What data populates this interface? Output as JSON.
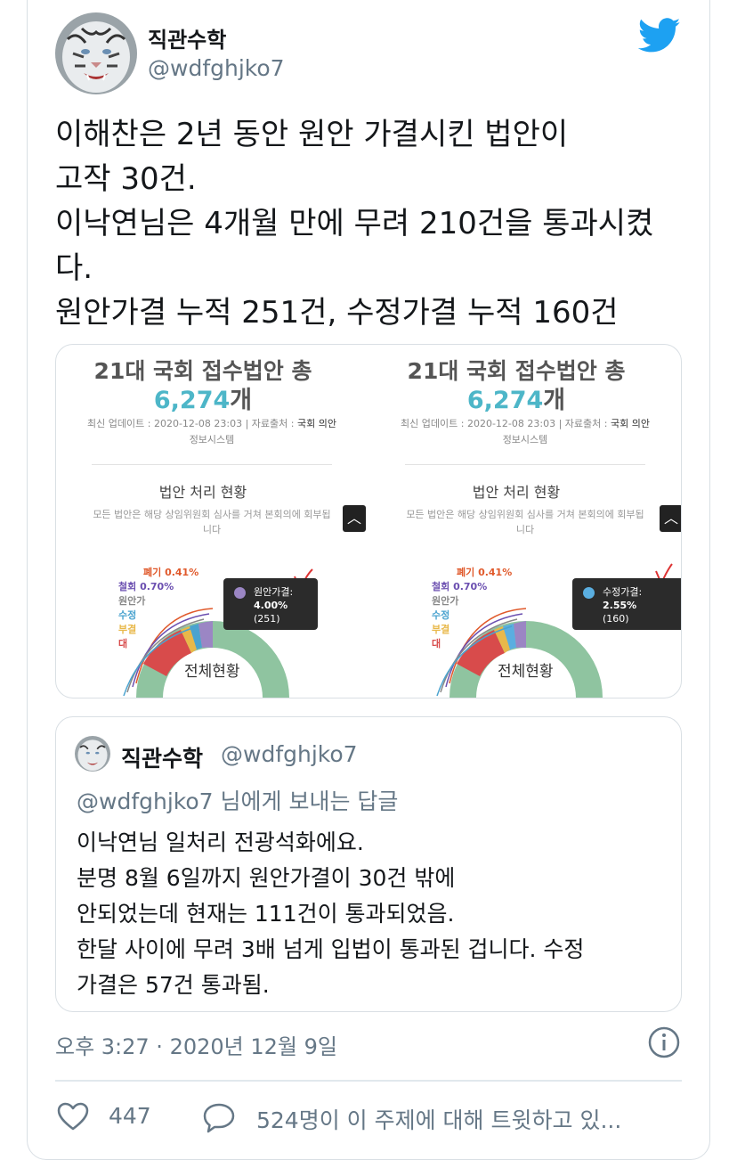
{
  "author": {
    "name": "직관수학",
    "handle": "@wdfghjko7"
  },
  "tweet": {
    "lines": [
      "이해찬은 2년 동안 원안 가결시킨 법안이",
      "고작 30건.",
      "이낙연님은 4개월 만에 무려 210건을 통과시켰",
      "다.",
      "원안가결 누적 251건, 수정가결 누적 160건"
    ]
  },
  "media": {
    "panels": [
      {
        "title": "21대 국회 접수법안 총",
        "count_number": "6,274",
        "count_unit": "개",
        "meta_prefix": "최신 업데이트 : 2020-12-08 23:03 | 자료출처 : ",
        "meta_source": "국회 의안",
        "meta_line2": "정보시스템",
        "subtitle": "법안 처리 현황",
        "desc_line1": "모든 법안은 해당 상임위원회 심사를 거쳐 본회의에 회부됩",
        "desc_line2": "니다",
        "scroll_glyph": "︿",
        "legend": [
          "폐기 0.41%",
          "철회 0.70%",
          "원안가",
          "수정",
          "부결",
          "대"
        ],
        "center_label": "전체현황",
        "tooltip": {
          "label": "원안가결:",
          "percent": "4.00%",
          "count": "(251)",
          "color": "#9b86c4"
        }
      },
      {
        "title": "21대 국회 접수법안 총",
        "count_number": "6,274",
        "count_unit": "개",
        "meta_prefix": "최신 업데이트 : 2020-12-08 23:03 | 자료출처 : ",
        "meta_source": "국회 의안",
        "meta_line2": "정보시스템",
        "subtitle": "법안 처리 현황",
        "desc_line1": "모든 법안은 해당 상임위원회 심사를 거쳐 본회의에 회부됩",
        "desc_line2": "니다",
        "scroll_glyph": "︿",
        "legend": [
          "폐기 0.41%",
          "철회 0.70%",
          "원안가",
          "수정",
          "부결",
          "대"
        ],
        "center_label": "전체현황",
        "tooltip": {
          "label": "수정가결:",
          "percent": "2.55%",
          "count": "(160)",
          "color": "#5aaee0"
        }
      }
    ],
    "legend_colors": [
      "#e0592b",
      "#6b4fb0",
      "#888888",
      "#4aa3cf",
      "#e8b84a",
      "#d84b4b"
    ]
  },
  "quote": {
    "name": "직관수학",
    "handle": "@wdfghjko7",
    "reply_to_handle": "@wdfghjko7",
    "reply_to_suffix": " 님에게 보내는 답글",
    "lines": [
      "이낙연님 일처리 전광석화에요.",
      "분명 8월 6일까지 원안가결이 30건 밖에",
      "안되었는데 현재는 111건이 통과되었음.",
      "한달 사이에 무려 3배 넘게 입법이 통과된 겁니다. 수정",
      "가결은 57건 통과됨."
    ]
  },
  "footer": {
    "timestamp": "오후 3:27 · 2020년 12월 9일",
    "like_count": "447",
    "reply_text": "524명이 이 주제에 대해 트윗하고 있..."
  },
  "colors": {
    "twitter_blue": "#1da1f2",
    "secondary_text": "#657786",
    "donut_green": "#8fc4a0"
  }
}
